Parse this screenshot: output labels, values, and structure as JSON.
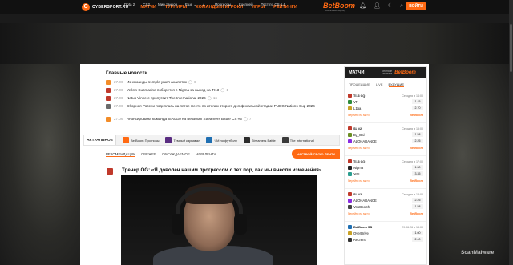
{
  "header": {
    "logo_mark": "C",
    "logo_text": "CYBERSPORT.RU",
    "nav": [
      "МАТЧИ",
      "ТУРНИРЫ",
      "КОМАНДЫ И ИГРОКИ",
      "ИГРЫ",
      "РЕЙТИНГИ"
    ],
    "sponsor": "BetBoom",
    "sponsor_sub": "Генеральный партнер",
    "icons": [
      "bell-icon",
      "user-icon",
      "moon-icon",
      "search-icon"
    ],
    "login_label": "ВОЙТИ"
  },
  "subheader": {
    "games": [
      "Dota 2",
      "CS2",
      "Мир танков",
      "Еще ⌄"
    ],
    "divider": "/",
    "links": [
      "Прогнозы",
      "Косплей",
      "Тест по CS 1.6"
    ]
  },
  "news": {
    "title": "Главные новости",
    "items": [
      {
        "time": "27.06",
        "text": "Из команды s1mple ушел аналитик",
        "count": "6",
        "color": "#f28c28"
      },
      {
        "time": "27.06",
        "text": "Yellow Submarine поборется с Nigma за выход на TI13",
        "count": "1",
        "color": "#c0392b"
      },
      {
        "time": "27.06",
        "text": "Natus Vincere пропустит The International 2026",
        "count": "16",
        "color": "#c0392b"
      },
      {
        "time": "27.06",
        "text": "Сборная России поднялась на пятое место по итогам второго дня финальной стадии PUBG Nations Cup 2026",
        "count": "",
        "color": "#6b6b6b"
      },
      {
        "time": "27.06",
        "text": "Анонсирована команда StRoGo на BetBoom Streamers Battle CS #5",
        "count": "7",
        "color": "#f28c28"
      }
    ]
  },
  "actual": {
    "label": "АКТУАЛЬНОЕ",
    "items": [
      {
        "text": "BetBoom Прогнозы",
        "color": "#ff6a13"
      },
      {
        "text": "Темный карнавал",
        "color": "#5a2d82"
      },
      {
        "text": "ЧМ по футболу",
        "color": "#1f6fb2"
      },
      {
        "text": "Streamers Battle",
        "color": "#2c2c2c"
      },
      {
        "text": "The International",
        "color": "#3a3a3a"
      }
    ]
  },
  "feed": {
    "tabs": [
      "РЕКОМЕНДАЦИИ",
      "СВЕЖЕЕ",
      "ОБСУЖДАЕМОЕ",
      "МОЯ ЛЕНТА"
    ],
    "active_tab": 0,
    "settings_button": "НАСТРОЙ СВОЮ ЛЕНТУ"
  },
  "article": {
    "title": "Тренер OG: «Я доволен нашим прогрессом с тех пор, как мы внесли изменения»",
    "count": "0"
  },
  "matches": {
    "title": "МАТЧИ",
    "sponsor_line1": "СПОНСОР",
    "sponsor_line2": "РУБРИКИ",
    "sponsor_name": "BetBoom",
    "tabs": [
      "ПРОШЕДШИЕ",
      "LIVE",
      "БУДУЩИЕ"
    ],
    "active_tab": 2,
    "link_label": "Перейти на матч",
    "bb_label": "BetBoom",
    "list": [
      {
        "league": "TI13 CQ",
        "time": "Сегодня в 14:00",
        "team1": "VP",
        "odds1": "1.45",
        "team2": "L1ga",
        "odds2": "2.70"
      },
      {
        "league": "SL #2",
        "time": "Сегодня в 15:00",
        "team1": "By_Dal",
        "odds1": "1.58",
        "team2": "ALOHADANCE",
        "odds2": "2.25"
      },
      {
        "league": "TI13 CQ",
        "time": "Сегодня в 17:00",
        "team1": "Nigma",
        "odds1": "1.30",
        "team2": "YeS",
        "odds2": "3.35"
      },
      {
        "league": "SL #2",
        "time": "Сегодня в 18:00",
        "team1": "ALOHADANCE",
        "odds1": "2.25",
        "team2": "VooDooSh",
        "odds2": "1.58"
      },
      {
        "league": "BetBoom SB",
        "time": "29.06.26 в 13:00",
        "team1": "OverDrive",
        "odds1": "1.60",
        "team2": "Recrent",
        "odds2": "2.40"
      }
    ]
  },
  "watermark": "ScanMalware"
}
